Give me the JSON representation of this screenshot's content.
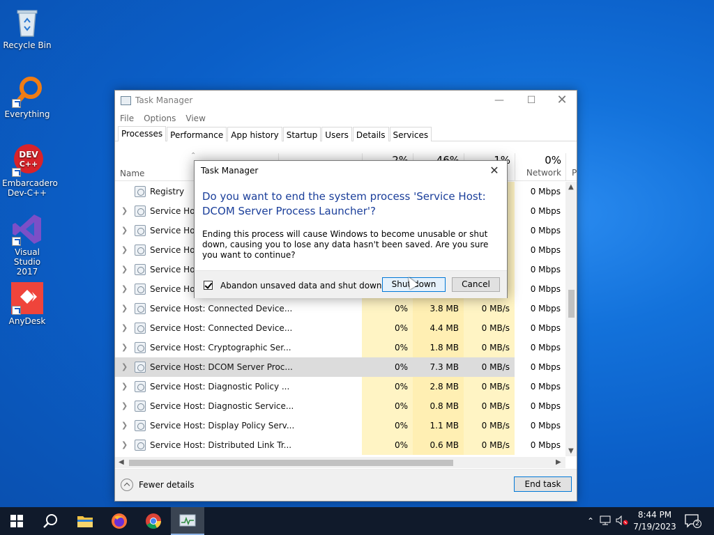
{
  "desktop": {
    "icons": [
      {
        "label": "Recycle Bin"
      },
      {
        "label": "Everything"
      },
      {
        "label": "Embarcadero Dev-C++"
      },
      {
        "label": "Visual Studio 2017"
      },
      {
        "label": "AnyDesk"
      }
    ]
  },
  "task_manager": {
    "title": "Task Manager",
    "menu": [
      "File",
      "Options",
      "View"
    ],
    "tabs": [
      "Processes",
      "Performance",
      "App history",
      "Startup",
      "Users",
      "Details",
      "Services"
    ],
    "active_tab": "Processes",
    "columns": {
      "name": "Name",
      "cpu_pct": "2%",
      "mem_pct": "46%",
      "disk_pct": "1%",
      "net_pct": "0%",
      "net_label": "Network",
      "power_label": "P"
    },
    "rows": [
      {
        "name": "Registry",
        "cpu": "",
        "mem": "",
        "disk": "",
        "net": "0 Mbps",
        "expandable": false
      },
      {
        "name": "Service Host",
        "cpu": "",
        "mem": "",
        "disk": "",
        "net": "0 Mbps",
        "expandable": true
      },
      {
        "name": "Service Host",
        "cpu": "",
        "mem": "",
        "disk": "",
        "net": "0 Mbps",
        "expandable": true
      },
      {
        "name": "Service Host",
        "cpu": "",
        "mem": "",
        "disk": "",
        "net": "0 Mbps",
        "expandable": true
      },
      {
        "name": "Service Host",
        "cpu": "",
        "mem": "",
        "disk": "",
        "net": "0 Mbps",
        "expandable": true
      },
      {
        "name": "Service Host",
        "cpu": "",
        "mem": "",
        "disk": "",
        "net": "0 Mbps",
        "expandable": true
      },
      {
        "name": "Service Host: Connected Device...",
        "cpu": "0%",
        "mem": "3.8 MB",
        "disk": "0 MB/s",
        "net": "0 Mbps",
        "expandable": true
      },
      {
        "name": "Service Host: Connected Device...",
        "cpu": "0%",
        "mem": "4.4 MB",
        "disk": "0 MB/s",
        "net": "0 Mbps",
        "expandable": true
      },
      {
        "name": "Service Host: Cryptographic Ser...",
        "cpu": "0%",
        "mem": "1.8 MB",
        "disk": "0 MB/s",
        "net": "0 Mbps",
        "expandable": true
      },
      {
        "name": "Service Host: DCOM Server Proc...",
        "cpu": "0%",
        "mem": "7.3 MB",
        "disk": "0 MB/s",
        "net": "0 Mbps",
        "expandable": true,
        "selected": true
      },
      {
        "name": "Service Host: Diagnostic Policy ...",
        "cpu": "0%",
        "mem": "2.8 MB",
        "disk": "0 MB/s",
        "net": "0 Mbps",
        "expandable": true
      },
      {
        "name": "Service Host: Diagnostic Service...",
        "cpu": "0%",
        "mem": "0.8 MB",
        "disk": "0 MB/s",
        "net": "0 Mbps",
        "expandable": true
      },
      {
        "name": "Service Host: Display Policy Serv...",
        "cpu": "0%",
        "mem": "1.1 MB",
        "disk": "0 MB/s",
        "net": "0 Mbps",
        "expandable": true
      },
      {
        "name": "Service Host: Distributed Link Tr...",
        "cpu": "0%",
        "mem": "0.6 MB",
        "disk": "0 MB/s",
        "net": "0 Mbps",
        "expandable": true
      }
    ],
    "footer": {
      "fewer_details": "Fewer details",
      "end_task": "End task"
    }
  },
  "dialog": {
    "title": "Task Manager",
    "question": "Do you want to end the system process 'Service Host: DCOM Server Process Launcher'?",
    "message": "Ending this process will cause Windows to become unusable or shut down, causing you to lose any data hasn't been saved. Are you sure you want to continue?",
    "checkbox_label": "Abandon unsaved data and shut down.",
    "checkbox_checked": true,
    "primary_button": "Shut down",
    "cancel_button": "Cancel"
  },
  "taskbar": {
    "time": "8:44 PM",
    "date": "7/19/2023",
    "notification_count": "2"
  },
  "colors": {
    "desktop_blue": "#0b5fc8",
    "heat_yellow": "#fff4c4",
    "dialog_heading": "#1a3e9a",
    "accent": "#0078d7"
  }
}
